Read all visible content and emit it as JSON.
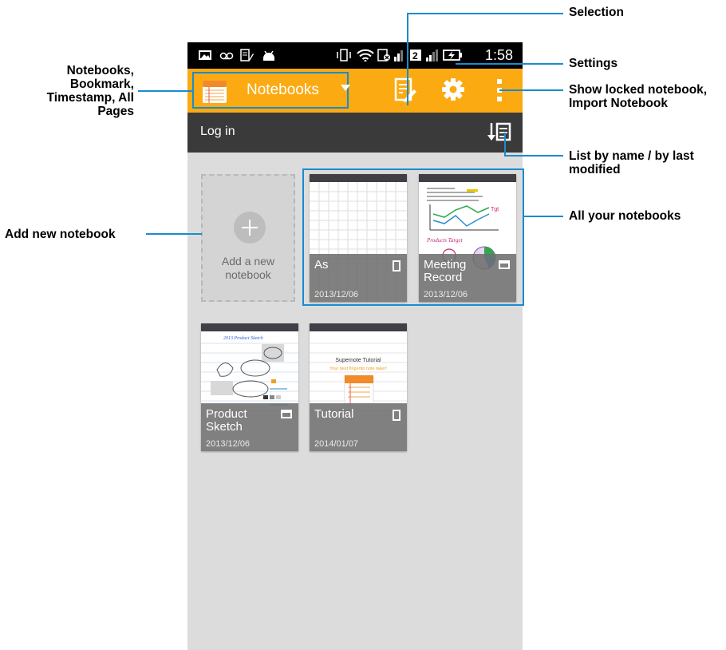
{
  "status_bar": {
    "time": "1:58"
  },
  "action_bar": {
    "notebook_selector_label": "Notebooks",
    "colors": {
      "accent": "#fbaa12",
      "highlight": "#1a8bd0"
    }
  },
  "sub_bar": {
    "login_label": "Log in"
  },
  "add_notebook": {
    "label": "Add a new notebook"
  },
  "notebooks": [
    {
      "name": "As",
      "date": "2013/12/06",
      "orientation": "portrait"
    },
    {
      "name": "Meeting Record",
      "date": "2013/12/06",
      "orientation": "landscape"
    },
    {
      "name": "Product Sketch",
      "date": "2013/12/06",
      "orientation": "landscape"
    },
    {
      "name": "Tutorial",
      "date": "2014/01/07",
      "orientation": "portrait"
    }
  ],
  "thumb_text": {
    "sketch_title": "2013 Product Sketch",
    "tutorial_title": "Supernote Tutorial",
    "tutorial_subtitle": "Your best fingertip note taker!",
    "meeting_chart_title": "Products Target"
  },
  "callouts": {
    "selection": "Selection",
    "settings": "Settings",
    "locked_import": "Show locked notebook, Import Notebook",
    "sort": "List by name / by last modified",
    "all_notebooks": "All your notebooks",
    "notebooks_menu": "Notebooks, Bookmark, Timestamp, All Pages",
    "add_new": "Add new notebook"
  }
}
